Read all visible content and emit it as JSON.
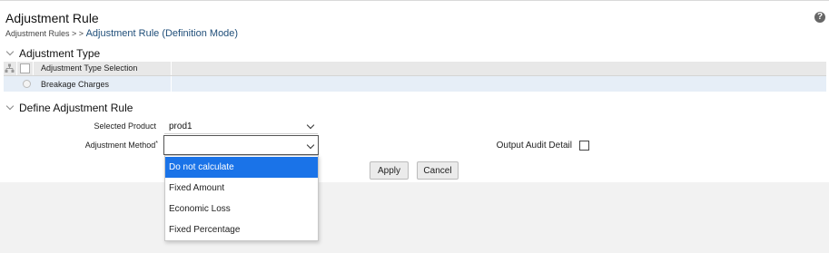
{
  "page": {
    "title": "Adjustment Rule",
    "breadcrumb": {
      "parent": "Adjustment Rules",
      "separator": " > > ",
      "current": "Adjustment Rule (Definition Mode)"
    },
    "help_icon": "?"
  },
  "adjustment_type": {
    "heading": "Adjustment Type",
    "column_header": "Adjustment Type Selection",
    "rows": [
      {
        "label": "Breakage Charges",
        "selected": false
      }
    ]
  },
  "define_rule": {
    "heading": "Define Adjustment Rule",
    "selected_product": {
      "label": "Selected Product",
      "value": "prod1"
    },
    "adjustment_method": {
      "label": "Adjustment Method",
      "required_mark": "*",
      "value": "",
      "options": [
        "Do not calculate",
        "Fixed Amount",
        "Economic Loss",
        "Fixed Percentage"
      ],
      "highlighted": "Do not calculate"
    },
    "output_audit": {
      "label": "Output Audit Detail",
      "checked": false
    },
    "buttons": {
      "apply": "Apply",
      "cancel": "Cancel"
    }
  },
  "colors": {
    "accent": "#1a73e8",
    "link": "#1f4e79",
    "row_selected": "#e6eef7"
  }
}
